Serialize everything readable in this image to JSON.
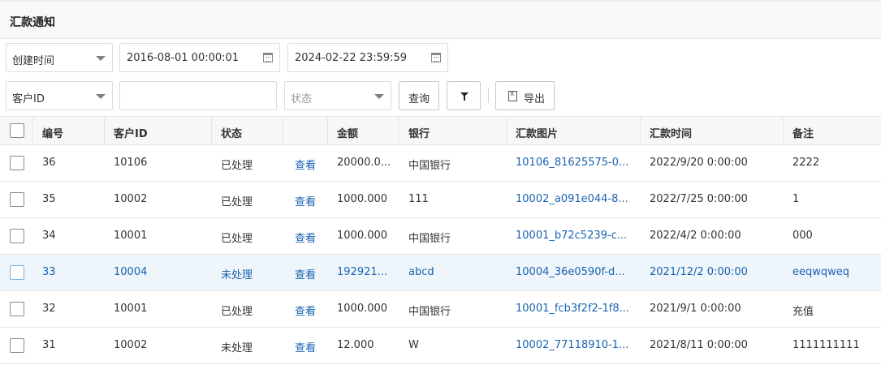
{
  "page": {
    "title": "汇款通知"
  },
  "filters": {
    "field_select": {
      "value": "创建时间"
    },
    "date_start": "2016-08-01 00:00:01",
    "date_end": "2024-02-22 23:59:59",
    "key_select": {
      "value": "客户ID"
    },
    "key_input": {
      "value": ""
    },
    "status_select": {
      "placeholder": "状态"
    },
    "query_label": "查询",
    "export_label": "导出"
  },
  "table": {
    "headers": [
      "编号",
      "客户ID",
      "状态",
      "",
      "金额",
      "银行",
      "汇款图片",
      "汇款时间",
      "备注"
    ],
    "rows": [
      {
        "id": "36",
        "customer_id": "10106",
        "status": "已处理",
        "view": "查看",
        "amount": "20000.0...",
        "bank": "中国银行",
        "image": "10106_81625575-0...",
        "time": "2022/9/20 0:00:00",
        "note": "2222"
      },
      {
        "id": "35",
        "customer_id": "10002",
        "status": "已处理",
        "view": "查看",
        "amount": "1000.000",
        "bank": "111",
        "image": "10002_a091e044-8...",
        "time": "2022/7/25 0:00:00",
        "note": "1"
      },
      {
        "id": "34",
        "customer_id": "10001",
        "status": "已处理",
        "view": "查看",
        "amount": "1000.000",
        "bank": "中国银行",
        "image": "10001_b72c5239-c...",
        "time": "2022/4/2 0:00:00",
        "note": "000"
      },
      {
        "id": "33",
        "customer_id": "10004",
        "status": "未处理",
        "view": "查看",
        "amount": "192921...",
        "bank": "abcd",
        "image": "10004_36e0590f-d...",
        "time": "2021/12/2 0:00:00",
        "note": "eeqwqweq"
      },
      {
        "id": "32",
        "customer_id": "10001",
        "status": "已处理",
        "view": "查看",
        "amount": "1000.000",
        "bank": "中国银行",
        "image": "10001_fcb3f2f2-1f8...",
        "time": "2021/9/1 0:00:00",
        "note": "充值"
      },
      {
        "id": "31",
        "customer_id": "10002",
        "status": "未处理",
        "view": "查看",
        "amount": "12.000",
        "bank": "W",
        "image": "10002_77118910-1...",
        "time": "2021/8/11 0:00:00",
        "note": "1111111111"
      }
    ]
  },
  "colors": {
    "link": "#1a63b0",
    "highlight_row": "#eef5fb"
  }
}
